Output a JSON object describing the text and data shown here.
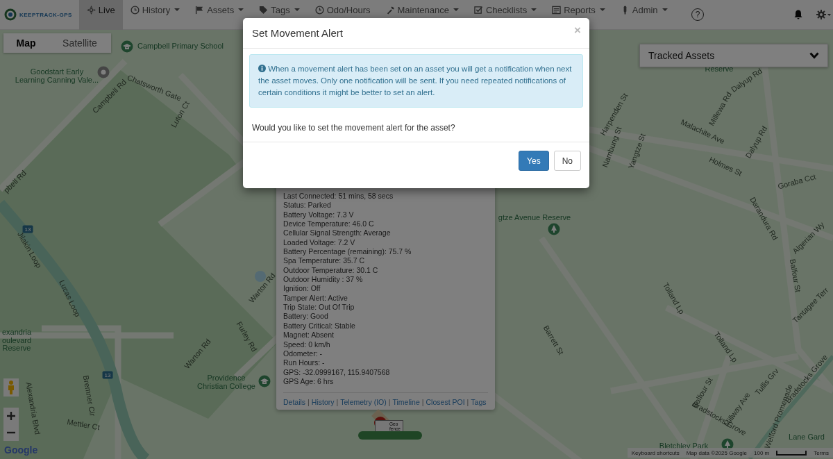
{
  "navbar": {
    "brand": "KEEPTRACK-GPS",
    "items": [
      {
        "label": "Live",
        "kind": "plain",
        "selected": true
      },
      {
        "label": "History",
        "kind": "dropdown",
        "selected": false
      },
      {
        "label": "Assets",
        "kind": "dropdown",
        "selected": false
      },
      {
        "label": "Tags",
        "kind": "dropdown",
        "selected": false
      },
      {
        "label": "Odo/Hours",
        "kind": "plain",
        "selected": false
      },
      {
        "label": "Maintenance",
        "kind": "dropdown",
        "selected": false
      },
      {
        "label": "Checklists",
        "kind": "dropdown",
        "selected": false
      },
      {
        "label": "Reports",
        "kind": "dropdown",
        "selected": false
      },
      {
        "label": "Admin",
        "kind": "dropdown",
        "selected": false
      }
    ],
    "help": "?"
  },
  "map_type": [
    {
      "label": "Map",
      "selected": true
    },
    {
      "label": "Satellite",
      "selected": false
    }
  ],
  "tracked_assets": {
    "title": "Tracked Assets"
  },
  "map_labels": [
    {
      "text": "Campbell Primary School",
      "kind": "place"
    },
    {
      "text": "Goodstart Early\nLearning Canning Vale...",
      "kind": "place"
    },
    {
      "text": "Campbell Rd",
      "kind": "road"
    },
    {
      "text": "Chatsworth Gate",
      "kind": "road"
    },
    {
      "text": "Luton Ct",
      "kind": "road"
    },
    {
      "text": "pbell Rd",
      "kind": "road"
    },
    {
      "text": "Jilakin Loop",
      "kind": "road"
    },
    {
      "text": "Lucas Loop",
      "kind": "road"
    },
    {
      "text": "exandria\noulevard\nReserve",
      "kind": "place"
    },
    {
      "text": "Warton Rd",
      "kind": "road"
    },
    {
      "text": "Furley Rd",
      "kind": "road"
    },
    {
      "text": "Warton Rd",
      "kind": "road"
    },
    {
      "text": "Providence\nChristian College",
      "kind": "place"
    },
    {
      "text": "Alexandria Blvd",
      "kind": "road"
    },
    {
      "text": "Bremner Cir",
      "kind": "road"
    },
    {
      "text": "Mettler Ct",
      "kind": "road"
    },
    {
      "text": "Harpenden St",
      "kind": "road"
    },
    {
      "text": "Malachite Ave",
      "kind": "road"
    },
    {
      "text": "Millewa Rd",
      "kind": "road"
    },
    {
      "text": "Holmes St",
      "kind": "road"
    },
    {
      "text": "Dalyup Rd",
      "kind": "road"
    },
    {
      "text": "Goraba Cct",
      "kind": "road"
    },
    {
      "text": "Darandura Rd",
      "kind": "road"
    },
    {
      "text": "Balfour St",
      "kind": "road"
    },
    {
      "text": "Algerian Wy",
      "kind": "road"
    },
    {
      "text": "gtze Avenue Reserve",
      "kind": "place"
    },
    {
      "text": "Barrett St",
      "kind": "road"
    },
    {
      "text": "Tolland Lp",
      "kind": "road"
    },
    {
      "text": "Tolland Lp",
      "kind": "road"
    },
    {
      "text": "Balfour St",
      "kind": "road"
    },
    {
      "text": "Tullis Grv",
      "kind": "road"
    },
    {
      "text": "Bradstocks Grove",
      "kind": "road"
    },
    {
      "text": "Millway Ave",
      "kind": "road"
    },
    {
      "text": "Welford Promenade",
      "kind": "road"
    },
    {
      "text": "Bradstocks Grove",
      "kind": "road"
    },
    {
      "text": "Bletchley Park",
      "kind": "place"
    },
    {
      "text": "Lane Gard",
      "kind": "place"
    },
    {
      "text": "Nambung St",
      "kind": "road"
    },
    {
      "text": "Yangtze St",
      "kind": "road"
    },
    {
      "text": "Tantagee Terr",
      "kind": "road"
    },
    {
      "text": "Dalyup Rd",
      "kind": "road"
    },
    {
      "text": "Reserve",
      "kind": "place"
    }
  ],
  "route_shields": [
    "13",
    "13"
  ],
  "marker": {
    "label": "Geo\nfence"
  },
  "info_popup": {
    "rows": [
      "Last Connected: 51 mins, 58 secs",
      "Status: Parked",
      "Battery Voltage: 7.3 V",
      "Device Temperature: 46.0 C",
      "Cellular Signal Strength: Average",
      "Loaded Voltage: 7.2 V",
      "Battery Percentage (remaining): 75.7 %",
      "Spa Temperature: 35.7 C",
      "Outdoor Temperature: 30.1 C",
      "Outdoor Humidity : 37 %",
      "Ignition: Off",
      "Tamper Alert: Active",
      "Trip State: Out Of Trip",
      "Battery: Good",
      "Battery Critical: Stable",
      "Magnet: Absent",
      "Speed: 0 km/h",
      "Odometer: -",
      "Run Hours: -",
      "GPS: -32.0999167, 115.9407568",
      "GPS Age: 6 hrs"
    ],
    "separator": "|",
    "links": [
      "Details",
      "History",
      "Telemetry (IO)",
      "Timeline",
      "Closest POI",
      "Tags"
    ]
  },
  "map_footer": {
    "logo": "Google",
    "shortcuts": "Keyboard shortcuts",
    "map_data": "Map data ©2025 Google",
    "scale": "100 m",
    "terms": "Terms"
  },
  "modal": {
    "title": "Set Movement Alert",
    "close": "×",
    "alert": "When a movement alert has been set on an asset you will get a notification when next the asset moves. Only one notification will be sent. If you need repeated notifications of certain conditions it might be better to set an alert.",
    "question": "Would you like to set the movement alert for the asset?",
    "buttons": [
      {
        "label": "Yes",
        "kind": "primary"
      },
      {
        "label": "No",
        "kind": "default"
      }
    ]
  }
}
